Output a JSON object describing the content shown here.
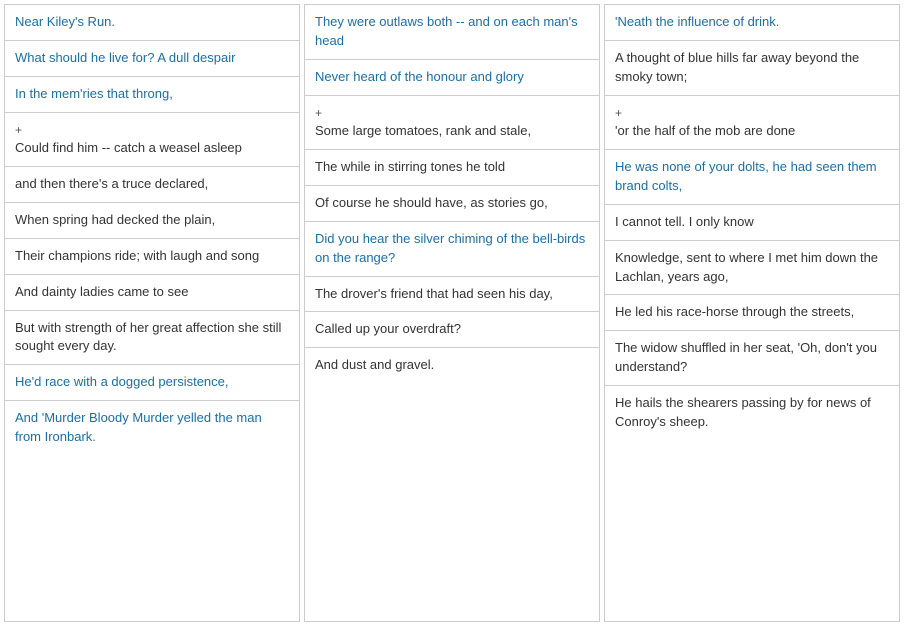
{
  "columns": [
    {
      "id": "col1",
      "cells": [
        {
          "id": "c1_1",
          "text": "Near Kiley's Run.",
          "color": "blue"
        },
        {
          "id": "c1_2",
          "text": "What should he live for? A dull despair",
          "color": "blue"
        },
        {
          "id": "c1_3",
          "text": "In the mem'ries that throng,",
          "color": "blue"
        },
        {
          "id": "c1_4",
          "text": "+\nCould find him -- catch a weasel asleep",
          "color": "dark",
          "plus": true
        },
        {
          "id": "c1_5",
          "text": "and then there's a truce declared,",
          "color": "dark"
        },
        {
          "id": "c1_6",
          "text": "When spring had decked the plain,",
          "color": "dark"
        },
        {
          "id": "c1_7",
          "text": "Their champions ride; with laugh and song",
          "color": "dark"
        },
        {
          "id": "c1_8",
          "text": "And dainty ladies came to see",
          "color": "dark"
        },
        {
          "id": "c1_9",
          "text": "But with strength of her great affection she still sought every day.",
          "color": "dark"
        },
        {
          "id": "c1_10",
          "text": "He'd race with a dogged persistence,",
          "color": "blue"
        },
        {
          "id": "c1_11",
          "text": "And 'Murder Bloody Murder yelled the man from Ironbark.",
          "color": "blue"
        }
      ]
    },
    {
      "id": "col2",
      "cells": [
        {
          "id": "c2_1",
          "text": "They were outlaws both -- and on each man's head",
          "color": "blue"
        },
        {
          "id": "c2_2",
          "text": "Never heard of the honour and glory",
          "color": "blue"
        },
        {
          "id": "c2_3",
          "text": "+\nSome large tomatoes, rank and stale,",
          "color": "dark",
          "plus": true
        },
        {
          "id": "c2_4",
          "text": "The while in stirring tones he told",
          "color": "dark"
        },
        {
          "id": "c2_5",
          "text": "Of course he should have, as stories go,",
          "color": "dark"
        },
        {
          "id": "c2_6",
          "text": "Did you hear the silver chiming of the bell-birds on the range?",
          "color": "blue"
        },
        {
          "id": "c2_7",
          "text": "The drover's friend that had seen his day,",
          "color": "dark"
        },
        {
          "id": "c2_8",
          "text": "Called up your overdraft?",
          "color": "dark"
        },
        {
          "id": "c2_9",
          "text": "And dust and gravel.",
          "color": "dark"
        }
      ]
    },
    {
      "id": "col3",
      "cells": [
        {
          "id": "c3_1",
          "text": "'Neath the influence of drink.",
          "color": "blue"
        },
        {
          "id": "c3_2",
          "text": "A thought of blue hills far away beyond the smoky town;",
          "color": "dark"
        },
        {
          "id": "c3_3",
          "text": "+\n'or the half of the mob are done",
          "color": "dark",
          "plus": true
        },
        {
          "id": "c3_4",
          "text": "He was none of your dolts, he had seen them brand colts,",
          "color": "blue"
        },
        {
          "id": "c3_5",
          "text": "I cannot tell. I only know",
          "color": "dark"
        },
        {
          "id": "c3_6",
          "text": "Knowledge, sent to where I met him down the Lachlan, years ago,",
          "color": "dark"
        },
        {
          "id": "c3_7",
          "text": "He led his race-horse through the streets,",
          "color": "dark"
        },
        {
          "id": "c3_8",
          "text": "The widow shuffled in her seat, 'Oh, don't you understand?",
          "color": "dark"
        },
        {
          "id": "c3_9",
          "text": "He hails the shearers passing by for news of Conroy's sheep.",
          "color": "dark"
        }
      ]
    }
  ]
}
